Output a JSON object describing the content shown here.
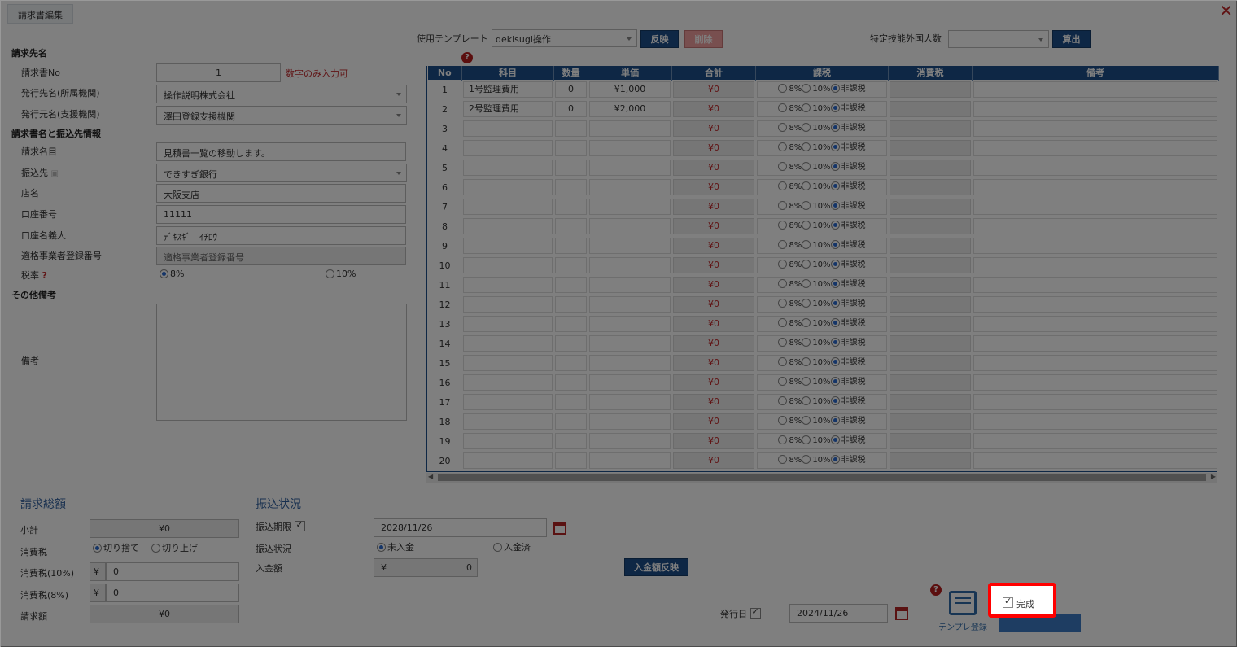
{
  "window": {
    "tab_title": "請求書編集",
    "close_label": "✕"
  },
  "template": {
    "label": "使用テンプレート",
    "value": "dekisugi操作",
    "apply_label": "反映",
    "delete_label": "削除"
  },
  "foreigners": {
    "label": "特定技能外国人数",
    "value": "",
    "calc_label": "算出"
  },
  "left": {
    "sec_billto": "請求先名",
    "invoice_no_label": "請求書No",
    "invoice_no": "1",
    "invoice_no_hint": "数字のみ入力可",
    "issue_to_label": "発行先名(所属機関)",
    "issue_to": "操作説明株式会社",
    "issue_from_label": "発行元名(支援機関)",
    "issue_from": "澤田登録支援機関",
    "sec_invoice": "請求書名と振込先情報",
    "title_label": "請求名目",
    "title": "見積書一覧の移動します。",
    "bank_label": "振込先",
    "bank": "できすぎ銀行",
    "branch_label": "店名",
    "branch": "大阪支店",
    "account_no_label": "口座番号",
    "account_no": "11111",
    "account_name_label": "口座名義人",
    "account_name": "ﾃﾞｷｽｷﾞ　ｲﾁﾛｳ",
    "reg_no_label": "適格事業者登録番号",
    "reg_no_placeholder": "適格事業者登録番号",
    "tax_label": "税率",
    "tax_q": "?",
    "tax_8": "8%",
    "tax_10": "10%",
    "sec_other": "その他備考",
    "note_label": "備考"
  },
  "table": {
    "headers": [
      "No",
      "科目",
      "数量",
      "単価",
      "合計",
      "課税",
      "消費税",
      "備考"
    ],
    "rate_8": "8%",
    "rate_10": "10%",
    "rate_none": "非課税",
    "rows": [
      {
        "no": "1",
        "item": "1号監理費用",
        "qty": "0",
        "price": "¥1,000",
        "total": "¥0"
      },
      {
        "no": "2",
        "item": "2号監理費用",
        "qty": "0",
        "price": "¥2,000",
        "total": "¥0"
      },
      {
        "no": "3",
        "item": "",
        "qty": "",
        "price": "",
        "total": "¥0"
      },
      {
        "no": "4",
        "item": "",
        "qty": "",
        "price": "",
        "total": "¥0"
      },
      {
        "no": "5",
        "item": "",
        "qty": "",
        "price": "",
        "total": "¥0"
      },
      {
        "no": "6",
        "item": "",
        "qty": "",
        "price": "",
        "total": "¥0"
      },
      {
        "no": "7",
        "item": "",
        "qty": "",
        "price": "",
        "total": "¥0"
      },
      {
        "no": "8",
        "item": "",
        "qty": "",
        "price": "",
        "total": "¥0"
      },
      {
        "no": "9",
        "item": "",
        "qty": "",
        "price": "",
        "total": "¥0"
      },
      {
        "no": "10",
        "item": "",
        "qty": "",
        "price": "",
        "total": "¥0"
      },
      {
        "no": "11",
        "item": "",
        "qty": "",
        "price": "",
        "total": "¥0"
      },
      {
        "no": "12",
        "item": "",
        "qty": "",
        "price": "",
        "total": "¥0"
      },
      {
        "no": "13",
        "item": "",
        "qty": "",
        "price": "",
        "total": "¥0"
      },
      {
        "no": "14",
        "item": "",
        "qty": "",
        "price": "",
        "total": "¥0"
      },
      {
        "no": "15",
        "item": "",
        "qty": "",
        "price": "",
        "total": "¥0"
      },
      {
        "no": "16",
        "item": "",
        "qty": "",
        "price": "",
        "total": "¥0"
      },
      {
        "no": "17",
        "item": "",
        "qty": "",
        "price": "",
        "total": "¥0"
      },
      {
        "no": "18",
        "item": "",
        "qty": "",
        "price": "",
        "total": "¥0"
      },
      {
        "no": "19",
        "item": "",
        "qty": "",
        "price": "",
        "total": "¥0"
      },
      {
        "no": "20",
        "item": "",
        "qty": "",
        "price": "",
        "total": "¥0"
      }
    ]
  },
  "totals": {
    "heading": "請求総額",
    "subtotal_label": "小計",
    "subtotal": "¥0",
    "tax_label": "消費税",
    "round_down": "切り捨て",
    "round_up": "切り上げ",
    "tax10_label": "消費税(10%)",
    "tax10": "0",
    "tax8_label": "消費税(8%)",
    "tax8": "0",
    "yen": "¥",
    "billed_label": "請求額",
    "billed": "¥0"
  },
  "payment": {
    "heading": "振込状況",
    "deadline_label": "振込期限",
    "deadline": "2028/11/26",
    "status_label": "振込状況",
    "unpaid": "未入金",
    "paid": "入金済",
    "amount_label": "入金額",
    "amount": "0",
    "yen": "¥",
    "apply_label": "入金額反映"
  },
  "issue": {
    "date_label": "発行日",
    "date": "2024/11/26"
  },
  "actions": {
    "template_register": "テンプレ登録",
    "complete_label": "完成"
  },
  "colors": {
    "accent": "#1d4f8b",
    "danger": "#c0282b",
    "highlight": "#ff0000"
  }
}
